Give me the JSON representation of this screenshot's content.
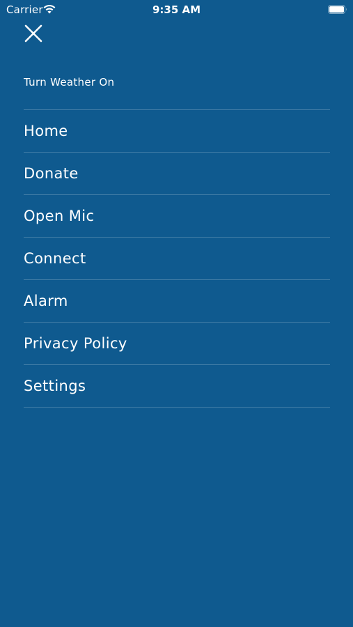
{
  "status_bar": {
    "carrier": "Carrier",
    "time": "9:35 AM",
    "wifi_icon": "wifi-icon",
    "battery_icon": "battery-icon"
  },
  "header": {
    "close_icon": "close-icon",
    "weather_toggle_label": "Turn Weather On"
  },
  "menu": {
    "items": [
      {
        "label": "Home"
      },
      {
        "label": "Donate"
      },
      {
        "label": "Open Mic"
      },
      {
        "label": "Connect"
      },
      {
        "label": "Alarm"
      },
      {
        "label": "Privacy Policy"
      },
      {
        "label": "Settings"
      }
    ]
  },
  "colors": {
    "background": "#0f5a8f",
    "text": "#ffffff",
    "divider": "rgba(255,255,255,0.22)"
  }
}
